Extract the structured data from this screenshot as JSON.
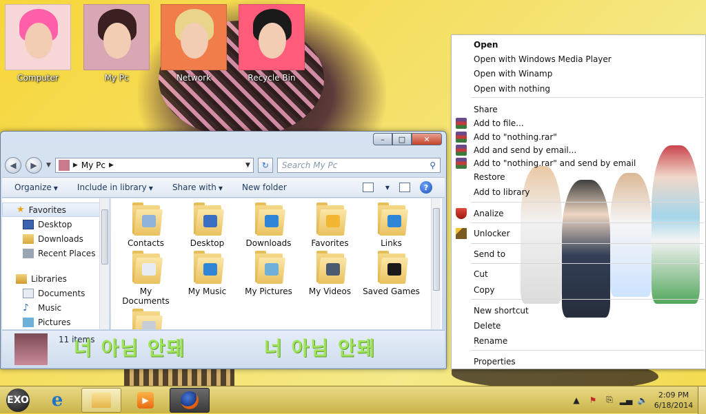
{
  "desktop_icons": [
    {
      "label": "Computer",
      "hair": "#ff5fa8",
      "bg": "#f6d6d6"
    },
    {
      "label": "My Pc",
      "hair": "#3a2020",
      "bg": "#d9a6b4"
    },
    {
      "label": "Network",
      "hair": "#e9d48c",
      "bg": "#f07d4a"
    },
    {
      "label": "Recycle Bin",
      "hair": "#1a1a1a",
      "bg": "#ff5c7c"
    }
  ],
  "explorer": {
    "address": "My Pc",
    "search_placeholder": "Search My Pc",
    "toolbar": {
      "organize": "Organize",
      "include": "Include in library",
      "share": "Share with",
      "new_folder": "New folder"
    },
    "nav": {
      "favorites": "Favorites",
      "desktop": "Desktop",
      "downloads": "Downloads",
      "recent": "Recent Places",
      "libraries": "Libraries",
      "documents": "Documents",
      "music": "Music",
      "pictures": "Pictures"
    },
    "files": [
      {
        "label": "Contacts",
        "badge": "#8fb3d9"
      },
      {
        "label": "Desktop",
        "badge": "#3a6ec4"
      },
      {
        "label": "Downloads",
        "badge": "#2f86d6"
      },
      {
        "label": "Favorites",
        "badge": "#f2b632"
      },
      {
        "label": "Links",
        "badge": "#2f86d6"
      },
      {
        "label": "My Documents",
        "badge": "#e8edf3"
      },
      {
        "label": "My Music",
        "badge": "#2f86d6"
      },
      {
        "label": "My Pictures",
        "badge": "#6fb0d8"
      },
      {
        "label": "My Videos",
        "badge": "#4a5a70"
      },
      {
        "label": "Saved Games",
        "badge": "#1a1a1a"
      },
      {
        "label": "",
        "badge": "#c8ced6"
      }
    ],
    "status": "11 items",
    "korean_text": "너 아님 안돼"
  },
  "context_menu": {
    "open": "Open",
    "open_wmp": "Open with Windows Media Player",
    "open_winamp": "Open with Winamp",
    "open_nothing": "Open with nothing",
    "share": "Share",
    "add_file": "Add to file...",
    "add_rar": "Add to \"nothing.rar\"",
    "add_email": "Add and send by email...",
    "add_rar_email": "Add to \"nothing.rar\" and send by email",
    "restore": "Restore",
    "add_library": "Add to library",
    "analize": "Analize",
    "unlocker": "Unlocker",
    "send_to": "Send to",
    "cut": "Cut",
    "copy": "Copy",
    "new_shortcut": "New shortcut",
    "delete": "Delete",
    "rename": "Rename",
    "properties": "Properties"
  },
  "taskbar": {
    "start_label": "EXO",
    "time": "2:09 PM",
    "date": "6/18/2014"
  }
}
